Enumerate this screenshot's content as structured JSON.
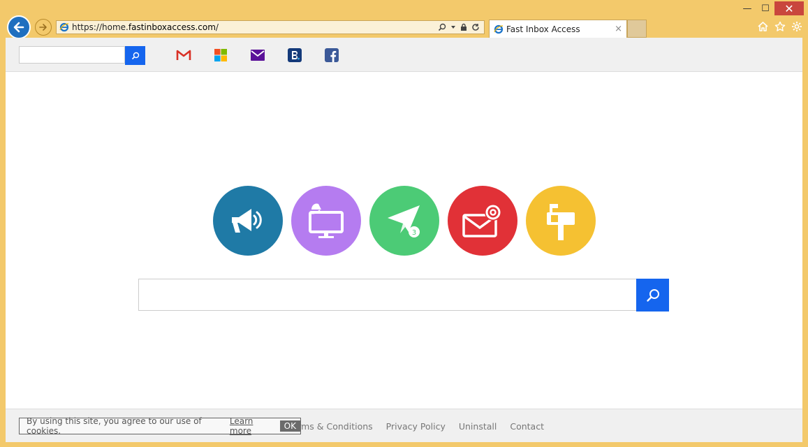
{
  "browser": {
    "url_prefix": "https://home.",
    "url_domain": "fastinboxaccess.com",
    "url_suffix": "/",
    "tab_title": "Fast Inbox Access",
    "tab_close": "×",
    "win_minimize": "—",
    "win_maximize": "☐",
    "win_close": "✕"
  },
  "shortcuts": [
    {
      "icon": "gmail-icon",
      "color": "#d93025"
    },
    {
      "icon": "microsoft-icon",
      "color": "#f25022"
    },
    {
      "icon": "yahoo-mail-icon",
      "color": "#5b1199"
    },
    {
      "icon": "booking-icon",
      "color": "#143a7a"
    },
    {
      "icon": "facebook-icon",
      "color": "#3b5998"
    }
  ],
  "feature_icons": [
    {
      "icon": "megaphone-icon",
      "color": "#1f7aa6"
    },
    {
      "icon": "monitor-bell-icon",
      "color": "#b57cf0"
    },
    {
      "icon": "paper-plane-icon",
      "color": "#4ccb76",
      "badge": "3"
    },
    {
      "icon": "envelope-at-icon",
      "color": "#e13137"
    },
    {
      "icon": "mailbox-icon",
      "color": "#f5c132"
    }
  ],
  "footer": {
    "links": [
      "Terms & Conditions",
      "Privacy Policy",
      "Uninstall",
      "Contact"
    ],
    "cookie_text": "By using this site, you agree to our use of cookies.",
    "cookie_learn": "Learn more",
    "cookie_ok": "OK"
  },
  "colors": {
    "accent": "#1565ee",
    "frame": "#f3c96b"
  }
}
